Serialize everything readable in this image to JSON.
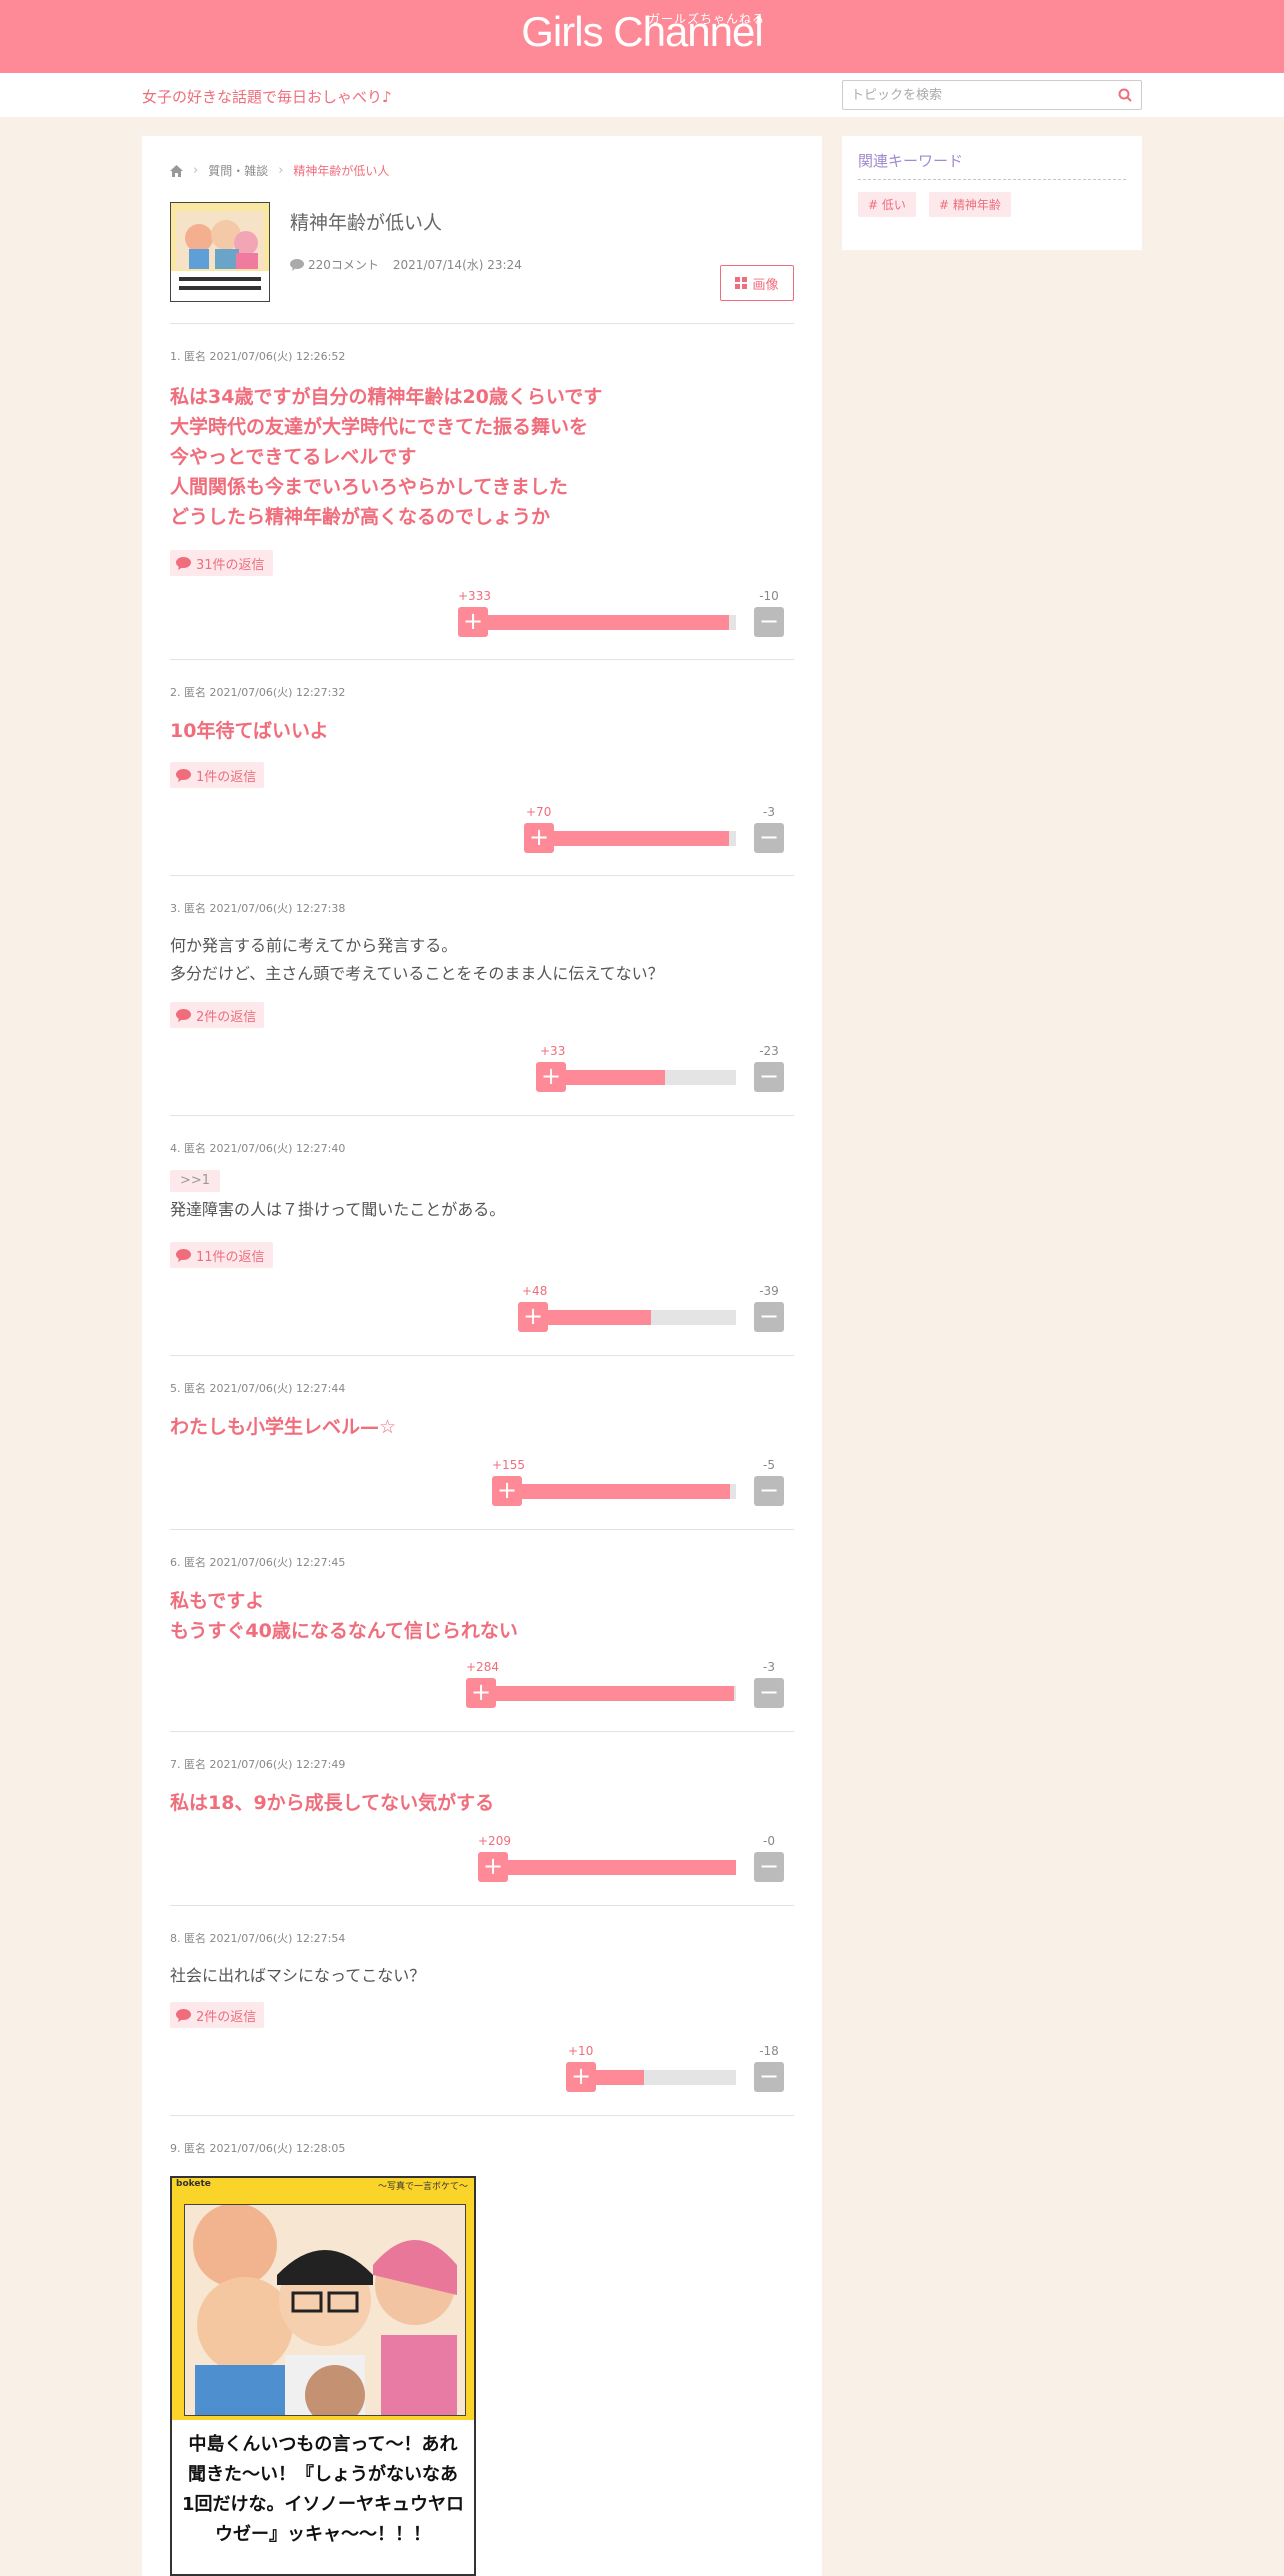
{
  "header": {
    "logo": "Girls Channel",
    "logo_kana": "ガールズちゃんねる",
    "tagline": "女子の好きな話題で毎日おしゃべり♪",
    "search_placeholder": "トピックを検索"
  },
  "breadcrumb": {
    "category": "質問・雑談",
    "current": "精神年齢が低い人"
  },
  "topic": {
    "title": "精神年齢が低い人",
    "comments": "220コメント",
    "date": "2021/07/14(水) 23:24",
    "image_button": "画像"
  },
  "comments": [
    {
      "meta": "1. 匿名 2021/07/06(火) 12:26:52",
      "body": "私は34歳ですが自分の精神年齢は20歳くらいです\n大学時代の友達が大学時代にできてた振る舞いを\n今やっとできてるレベルです\n人間関係も今までいろいろやらかしてきました\nどうしたら精神年齢が高くなるのでしょうか",
      "replies": "31件の返信",
      "plus": "+333",
      "minus": "-10",
      "ratio": 0.97
    },
    {
      "meta": "2. 匿名 2021/07/06(火) 12:27:32",
      "body": "10年待てばいいよ",
      "replies": "1件の返信",
      "plus": "+70",
      "minus": "-3",
      "ratio": 0.96
    },
    {
      "meta": "3. 匿名 2021/07/06(火) 12:27:38",
      "body": "何か発言する前に考えてから発言する。\n多分だけど、主さん頭で考えていることをそのまま人に伝えてない？",
      "replies": "2件の返信",
      "plus": "+33",
      "minus": "-23",
      "ratio": 0.59
    },
    {
      "meta": "4. 匿名 2021/07/06(火) 12:27:40",
      "anchor": ">>1",
      "body": "発達障害の人は７掛けって聞いたことがある。",
      "replies": "11件の返信",
      "plus": "+48",
      "minus": "-39",
      "ratio": 0.55
    },
    {
      "meta": "5. 匿名 2021/07/06(火) 12:27:44",
      "body": "わたしも小学生レベル—☆",
      "plus": "+155",
      "minus": "-5",
      "ratio": 0.97
    },
    {
      "meta": "6. 匿名 2021/07/06(火) 12:27:45",
      "body": "私もですよ\nもうすぐ40歳になるなんて信じられない",
      "plus": "+284",
      "minus": "-3",
      "ratio": 0.99
    },
    {
      "meta": "7. 匿名 2021/07/06(火) 12:27:49",
      "body": "私は18、9から成長してない気がする",
      "plus": "+209",
      "minus": "-0",
      "ratio": 1.0
    },
    {
      "meta": "8. 匿名 2021/07/06(火) 12:27:54",
      "body": "社会に出ればマシになってこない？",
      "replies": "2件の返信",
      "plus": "+10",
      "minus": "-18",
      "ratio": 0.36
    },
    {
      "meta": "9. 匿名 2021/07/06(火) 12:28:05"
    }
  ],
  "bokete": {
    "brand": "bokete",
    "tag": "〜写真で一言ボケて〜",
    "caption": "中島くんいつもの言って〜！あれ\n聞きた〜い！『しょうがないなあ\n1回だけな。イソノーヤキュウヤロ\nウゼー』ッキャ〜〜！！！"
  },
  "sidebar": {
    "heading": "関連キーワード",
    "keywords": [
      "# 低い",
      "# 精神年齢"
    ]
  },
  "colors": {
    "brand": "#fd8a96",
    "accent": "#f06d7c",
    "background": "#f9f1e8"
  }
}
